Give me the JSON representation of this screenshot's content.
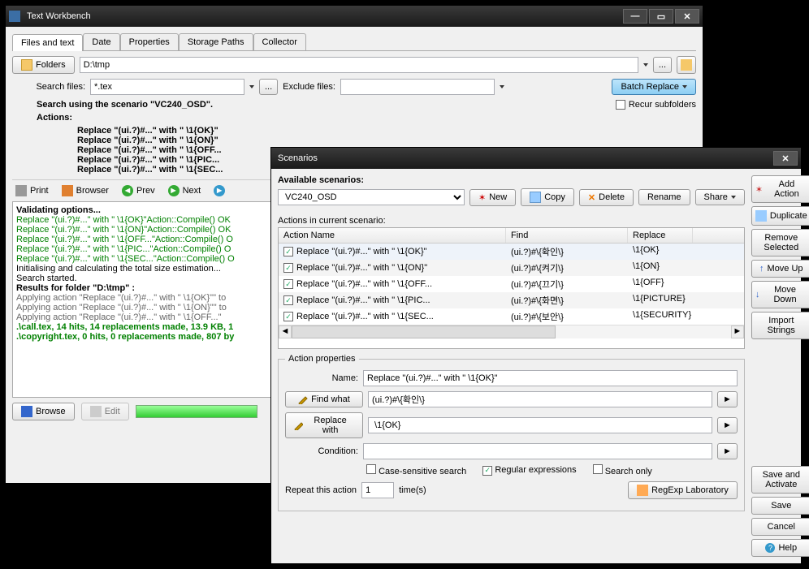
{
  "mainWin": {
    "title": "Text Workbench",
    "tabs": [
      "Files and text",
      "Date",
      "Properties",
      "Storage Paths",
      "Collector"
    ],
    "foldersBtn": "Folders",
    "path": "D:\\tmp",
    "searchFilesLbl": "Search files:",
    "searchFiles": "*.tex",
    "excludeFilesLbl": "Exclude files:",
    "batchReplace": "Batch Replace",
    "recurSubfolders": "Recur subfolders",
    "scenarioHeader": "Search using the scenario \"VC240_OSD\".",
    "actionsLbl": "Actions:",
    "actionsLines": [
      "Replace \"(ui.?)#...\" with \" \\1{OK}\"",
      "Replace \"(ui.?)#...\" with \" \\1{ON}\"",
      "Replace \"(ui.?)#...\" with \" \\1{OFF...",
      "Replace \"(ui.?)#...\" with \" \\1{PIC...",
      "Replace \"(ui.?)#...\" with \" \\1{SEC..."
    ],
    "toolbar": {
      "print": "Print",
      "browser": "Browser",
      "prev": "Prev",
      "next": "Next"
    },
    "log": [
      {
        "cls": "bold",
        "t": "Validating options..."
      },
      {
        "cls": "green",
        "t": "Replace \"(ui.?)#...\" with \" \\1{OK}\"Action::Compile() OK"
      },
      {
        "cls": "green",
        "t": "Replace \"(ui.?)#...\" with \" \\1{ON}\"Action::Compile() OK"
      },
      {
        "cls": "green",
        "t": "Replace \"(ui.?)#...\" with \" \\1{OFF...\"Action::Compile() O"
      },
      {
        "cls": "green",
        "t": "Replace \"(ui.?)#...\" with \" \\1{PIC...\"Action::Compile() O"
      },
      {
        "cls": "green",
        "t": "Replace \"(ui.?)#...\" with \" \\1{SEC...\"Action::Compile() O"
      },
      {
        "cls": "",
        "t": "Initialising and calculating the total size estimation..."
      },
      {
        "cls": "",
        "t": "Search started."
      },
      {
        "cls": "bold",
        "t": "Results for folder \"D:\\tmp\" :"
      },
      {
        "cls": "gray",
        "t": "Applying action \"Replace \"(ui.?)#...\" with \" \\1{OK}\"\" to"
      },
      {
        "cls": "gray",
        "t": "Applying action \"Replace \"(ui.?)#...\" with \" \\1{ON}\"\" to"
      },
      {
        "cls": "gray",
        "t": "Applying action \"Replace \"(ui.?)#...\" with \" \\1{OFF...\""
      },
      {
        "cls": "greenb",
        "t": ".\\call.tex, 14 hits, 14 replacements made, 13.9 KB, 1"
      },
      {
        "cls": "greenb",
        "t": ".\\copyright.tex, 0 hits, 0 replacements made, 807 by"
      }
    ],
    "browse": "Browse",
    "edit": "Edit"
  },
  "scenWin": {
    "title": "Scenarios",
    "availLbl": "Available scenarios:",
    "selected": "VC240_OSD",
    "btns": {
      "new": "New",
      "copy": "Copy",
      "delete": "Delete",
      "rename": "Rename",
      "share": "Share"
    },
    "actionsLbl": "Actions in current scenario:",
    "cols": {
      "name": "Action Name",
      "find": "Find",
      "replace": "Replace"
    },
    "rows": [
      {
        "name": "Replace \"(ui.?)#...\" with \" \\1{OK}\"",
        "find": "(ui.?)#\\{확인\\}",
        "replace": "\\1{OK}"
      },
      {
        "name": "Replace \"(ui.?)#...\" with \" \\1{ON}\"",
        "find": "(ui.?)#\\{켜기\\}",
        "replace": "\\1{ON}"
      },
      {
        "name": "Replace \"(ui.?)#...\" with \" \\1{OFF...",
        "find": "(ui.?)#\\{끄기\\}",
        "replace": "\\1{OFF}"
      },
      {
        "name": "Replace \"(ui.?)#...\" with \" \\1{PIC...",
        "find": "(ui.?)#\\{화면\\}",
        "replace": "\\1{PICTURE}"
      },
      {
        "name": "Replace \"(ui.?)#...\" with \" \\1{SEC...",
        "find": "(ui.?)#\\{보안\\}",
        "replace": "\\1{SECURITY}"
      }
    ],
    "propsLegend": "Action properties",
    "nameLbl": "Name:",
    "nameVal": "Replace \"(ui.?)#...\" with \" \\1{OK}\"",
    "findWhat": "Find what",
    "findVal": "(ui.?)#\\{확인\\}",
    "replaceWith": "Replace with",
    "replaceVal": " \\1{OK}",
    "conditionLbl": "Condition:",
    "caseSens": "Case-sensitive search",
    "regex": "Regular expressions",
    "searchOnly": "Search only",
    "repeatLbl": "Repeat this action",
    "repeatVal": "1",
    "timesLbl": "time(s)",
    "regexLab": "RegExp Laboratory",
    "side": {
      "addAction": "Add Action",
      "duplicate": "Duplicate",
      "removeSel": "Remove Selected",
      "moveUp": "Move Up",
      "moveDown": "Move Down",
      "importStr": "Import Strings",
      "saveActivate": "Save and Activate",
      "save": "Save",
      "cancel": "Cancel",
      "help": "Help"
    }
  }
}
